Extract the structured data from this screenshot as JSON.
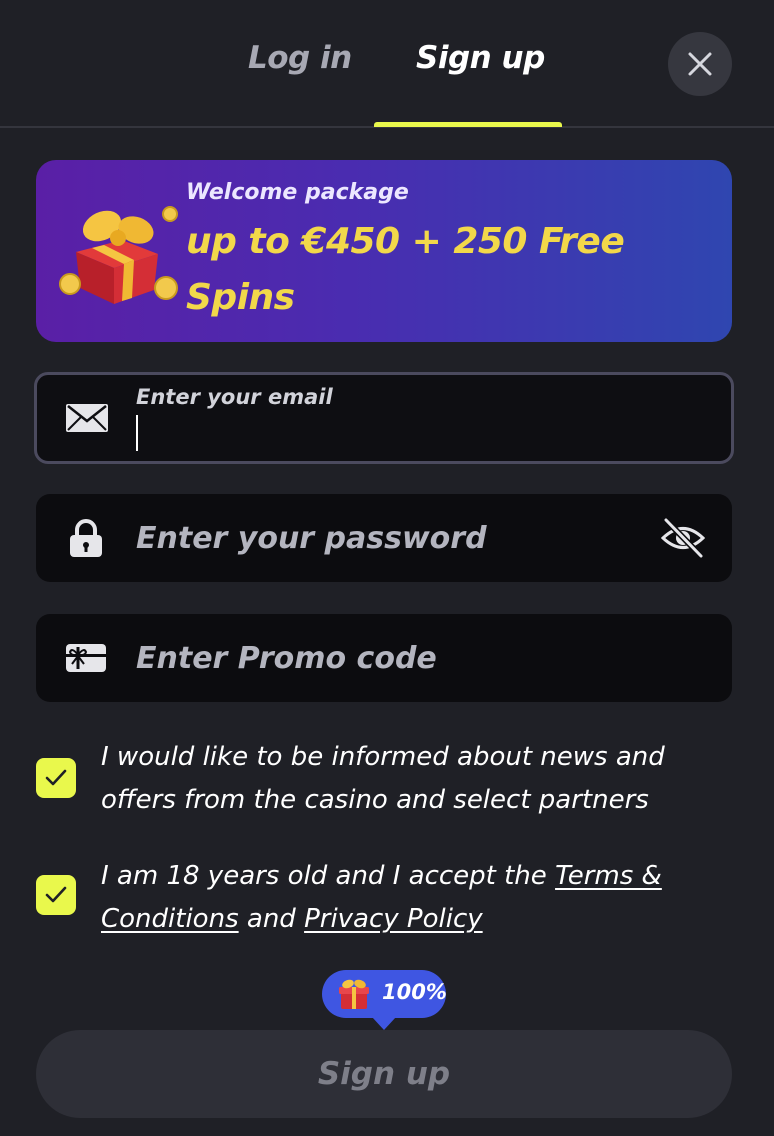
{
  "tabs": {
    "login_label": "Log in",
    "signup_label": "Sign up",
    "active": "signup"
  },
  "banner": {
    "subtitle": "Welcome package",
    "headline": "up to €450 + 250 Free Spins"
  },
  "form": {
    "email_label": "Enter your email",
    "email_value": "",
    "password_placeholder": "Enter your password",
    "promo_placeholder": "Enter Promo code"
  },
  "consents": {
    "news": {
      "checked": true,
      "text": "I would like to be informed about news and offers from the casino and select partners"
    },
    "terms": {
      "checked": true,
      "prefix": "I am 18 years old and I accept the",
      "terms_link": "Terms & Conditions",
      "joiner": "and",
      "privacy_link": "Privacy Policy"
    }
  },
  "bonus_badge": {
    "text": "100%"
  },
  "submit": {
    "label": "Sign up"
  },
  "colors": {
    "background": "#1f2026",
    "accent": "#e9f84c",
    "banner_headline": "#f2d84a",
    "badge": "#3f56e2"
  },
  "icons": {
    "close": "close-icon",
    "email": "envelope-icon",
    "password": "lock-icon",
    "toggle_visibility": "eye-off-icon",
    "promo": "gift-card-icon",
    "check": "checkmark-icon",
    "gift": "gift-box-icon"
  }
}
